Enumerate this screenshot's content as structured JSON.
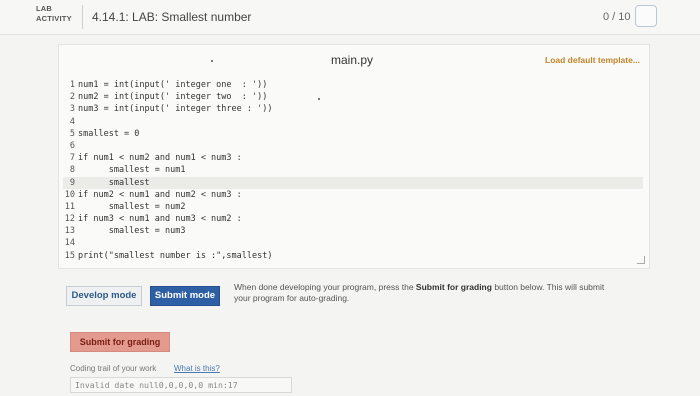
{
  "header": {
    "badge_line1": "LAB",
    "badge_line2": "ACTIVITY",
    "title": "4.14.1: LAB: Smallest number",
    "score": "0 / 10"
  },
  "editor": {
    "file_name": "main.py",
    "load_template": "Load default template...",
    "lines": [
      {
        "num": "1",
        "code": "num1 = int(input(' integer one  : '))"
      },
      {
        "num": "2",
        "code": "num2 = int(input(' integer two  : '))"
      },
      {
        "num": "3",
        "code": "num3 = int(input(' integer three : '))"
      },
      {
        "num": "4",
        "code": ""
      },
      {
        "num": "5",
        "code": "smallest = 0"
      },
      {
        "num": "6",
        "code": ""
      },
      {
        "num": "7",
        "code": "if num1 < num2 and num1 < num3 :"
      },
      {
        "num": "8",
        "code": "      smallest = num1"
      },
      {
        "num": "9",
        "code": "      smallest"
      },
      {
        "num": "10",
        "code": "if num2 < num1 and num2 < num3 :"
      },
      {
        "num": "11",
        "code": "      smallest = num2"
      },
      {
        "num": "12",
        "code": "if num3 < num1 and num3 < num2 :"
      },
      {
        "num": "13",
        "code": "      smallest = num3"
      },
      {
        "num": "14",
        "code": ""
      },
      {
        "num": "15",
        "code": "print(\"smallest number is :\",smallest)"
      }
    ],
    "active_line": 8
  },
  "actions": {
    "develop_label": "Develop mode",
    "submit_label": "Submit mode",
    "note_before": "When done developing your program, press the ",
    "note_bold": "Submit for grading",
    "note_after": " button below. This will submit your program for auto-grading.",
    "grade_label": "Submit for grading"
  },
  "trail": {
    "label": "Coding trail of your work",
    "link": "What is this?",
    "value": "Invalid date null0,0,0,0,0 min:17"
  },
  "colors": {
    "submit_mode_bg": "#2e5fa4",
    "grade_button_bg": "#e39a8f",
    "load_template_text": "#c0852a"
  }
}
